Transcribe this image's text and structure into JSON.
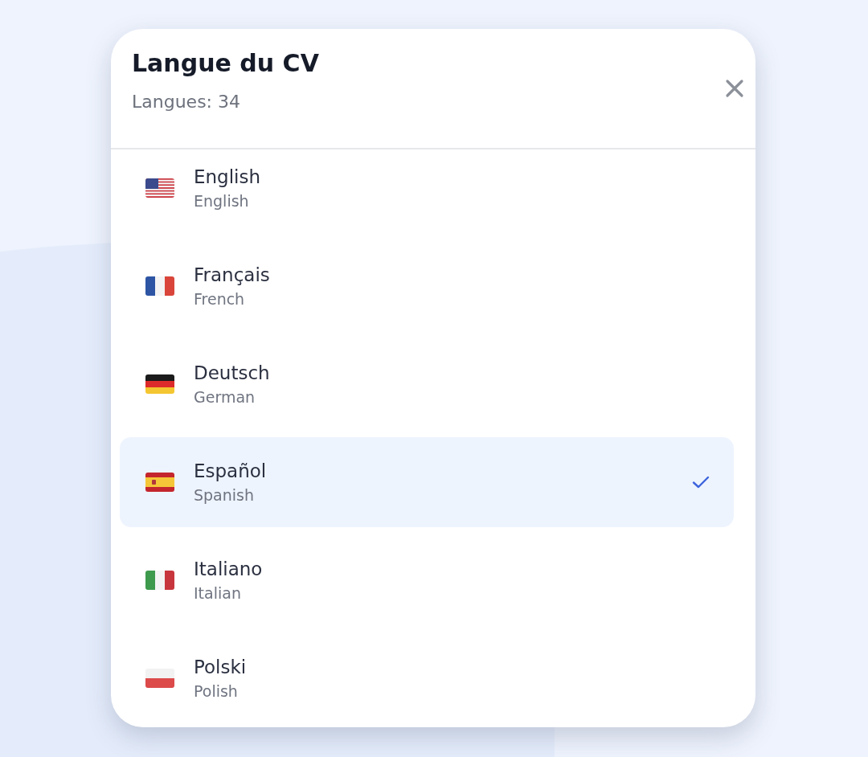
{
  "dialog": {
    "title": "Langue du CV",
    "subtitle": "Langues: 34"
  },
  "languages": [
    {
      "kind": "us",
      "name": "English",
      "translation": "English",
      "selected": false
    },
    {
      "kind": "fr",
      "name": "Français",
      "translation": "French",
      "selected": false
    },
    {
      "kind": "de",
      "name": "Deutsch",
      "translation": "German",
      "selected": false
    },
    {
      "kind": "es",
      "name": "Español",
      "translation": "Spanish",
      "selected": true
    },
    {
      "kind": "it",
      "name": "Italiano",
      "translation": "Italian",
      "selected": false
    },
    {
      "kind": "pl",
      "name": "Polski",
      "translation": "Polish",
      "selected": false
    }
  ]
}
